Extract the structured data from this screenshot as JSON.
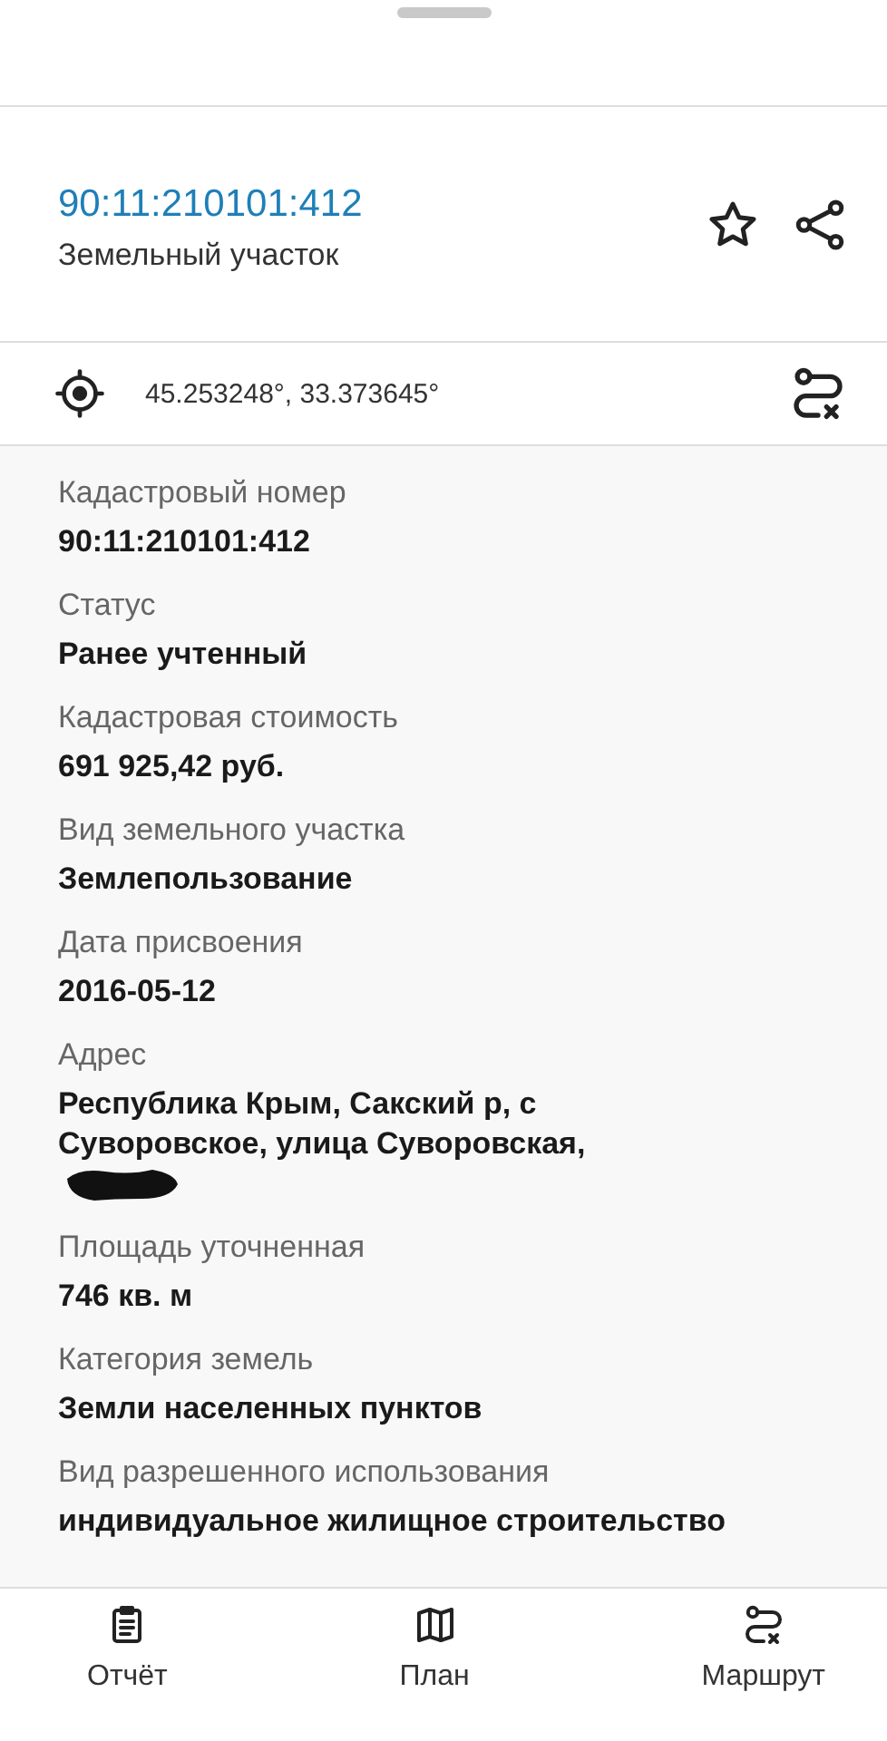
{
  "header": {
    "title": "90:11:210101:412",
    "subtitle": "Земельный участок"
  },
  "coordinates": "45.253248°, 33.373645°",
  "fields": [
    {
      "label": "Кадастровый номер",
      "value": "90:11:210101:412"
    },
    {
      "label": "Статус",
      "value": "Ранее учтенный"
    },
    {
      "label": "Кадастровая стоимость",
      "value": "691 925,42 руб."
    },
    {
      "label": "Вид земельного участка",
      "value": "Землепользование"
    },
    {
      "label": "Дата присвоения",
      "value": "2016-05-12"
    },
    {
      "label": "Адрес",
      "value": "Республика Крым, Сакский р, с Суворовское, улица Суворовская,",
      "redacted": true
    },
    {
      "label": "Площадь уточненная",
      "value": "746 кв. м"
    },
    {
      "label": "Категория земель",
      "value": "Земли населенных пунктов"
    },
    {
      "label": "Вид разрешенного использования",
      "value": "индивидуальное жилищное строительство"
    }
  ],
  "bottom_nav": [
    {
      "kind": "report",
      "label": "Отчёт"
    },
    {
      "kind": "plan",
      "label": "План"
    },
    {
      "kind": "route",
      "label": "Маршрут"
    }
  ]
}
